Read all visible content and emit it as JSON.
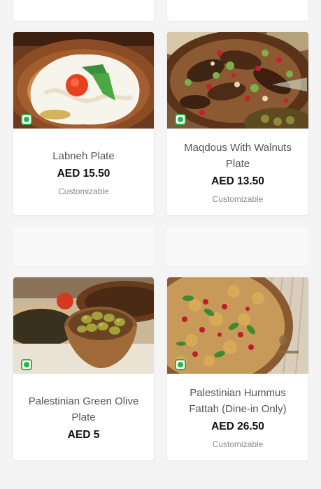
{
  "menu": {
    "items": [
      {
        "name": "Labneh Plate",
        "price": "AED 15.50",
        "tag": "Customizable",
        "veg": true,
        "image": "labneh-plate-photo"
      },
      {
        "name": "Maqdous With Walnuts Plate",
        "price": "AED 13.50",
        "tag": "Customizable",
        "veg": true,
        "image": "maqdous-plate-photo"
      },
      {
        "name": "Palestinian Green Olive Plate",
        "price": "AED 5",
        "tag": "",
        "veg": true,
        "image": "green-olive-plate-photo"
      },
      {
        "name": "Palestinian Hummus Fattah (Dine-in Only)",
        "price": "AED 26.50",
        "tag": "Customizable",
        "veg": true,
        "image": "hummus-fattah-photo"
      }
    ]
  },
  "colors": {
    "veg_badge": "#2fb24a",
    "price_text": "#111111",
    "name_text": "#555555",
    "tag_text": "#8a8a8a"
  }
}
